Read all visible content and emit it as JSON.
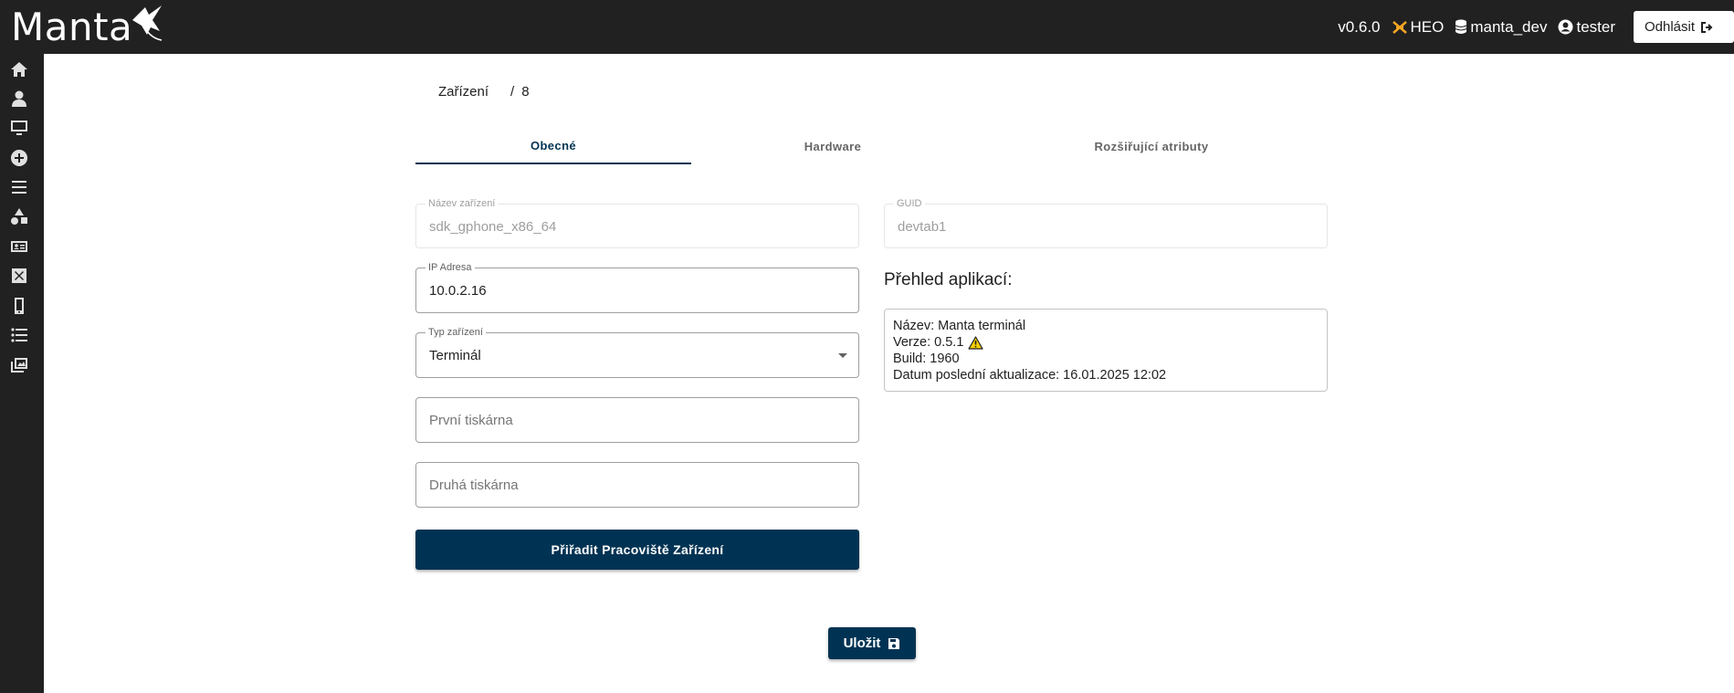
{
  "header": {
    "logo_text": "Manta",
    "version": "v0.6.0",
    "company": "HEO",
    "database": "manta_dev",
    "user": "tester",
    "logout_label": "Odhlásit"
  },
  "sidebar": {
    "icons": [
      "home-icon",
      "user-icon",
      "monitor-icon",
      "add-circle-icon",
      "menu-list-icon",
      "shapes-icon",
      "id-card-icon",
      "close-box-icon",
      "mobile-device-icon",
      "bullet-list-icon",
      "photo-library-icon"
    ]
  },
  "breadcrumb": {
    "parent": "Zařízení",
    "separator": "/",
    "current": "8"
  },
  "tabs": [
    {
      "label": "Obecné",
      "active": true
    },
    {
      "label": "Hardware",
      "active": false
    },
    {
      "label": "Rozšiřující atributy",
      "active": false
    }
  ],
  "form": {
    "device_name": {
      "label": "Název zařízení",
      "value": "sdk_gphone_x86_64"
    },
    "guid": {
      "label": "GUID",
      "value": "devtab1"
    },
    "ip_address": {
      "label": "IP Adresa",
      "value": "10.0.2.16"
    },
    "device_type": {
      "label": "Typ zařízení",
      "value": "Terminál"
    },
    "first_printer": {
      "placeholder": "První tiskárna"
    },
    "second_printer": {
      "placeholder": "Druhá tiskárna"
    },
    "assign_button": "Přiřadit Pracoviště Zařízení",
    "save_button": "Uložit"
  },
  "apps": {
    "heading": "Přehled aplikací:",
    "name_line": "Název: Manta terminál",
    "version_line": "Verze: 0.5.1",
    "build_line": "Build: 1960",
    "updated_line": "Datum poslední aktualizace: 16.01.2025 12:02",
    "warning_color": "#f5d000"
  },
  "colors": {
    "primary": "#003353",
    "topbar": "#212121"
  }
}
